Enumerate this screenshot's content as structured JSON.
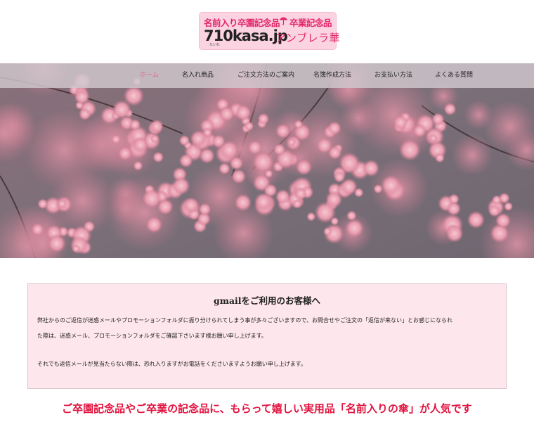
{
  "logo": {
    "line1_a": "名前入り卒園記念品",
    "line1_b": "卒業記念品",
    "domain": "710kasa.jp",
    "ruby": "ないれ",
    "brand": "アンブレラ華",
    "accent": "#e2266a",
    "background": "#fbd3e1",
    "icon": "umbrella-icon"
  },
  "nav": {
    "items": [
      {
        "label": "ホーム",
        "active": true
      },
      {
        "label": "名入れ商品",
        "active": false
      },
      {
        "label": "ご注文方法のご案内",
        "active": false
      },
      {
        "label": "名簿作成方法",
        "active": false
      },
      {
        "label": "お支払い方法",
        "active": false
      },
      {
        "label": "よくある質問",
        "active": false
      }
    ],
    "active_color": "#e45f8f"
  },
  "notice": {
    "title": "gmailをご利用のお客様へ",
    "paragraph1_line1": "弊社からのご返信が迷惑メールやプロモーションフォルダに振り分けられてしまう事が多々ございますので、お問合せやご注文の「返信が来ない」とお感じになられ",
    "paragraph1_line2": "た際は、迷惑メール、プロモーションフォルダをご確認下さいます様お願い申し上げます。",
    "paragraph2": "それでも返信メールが見当たらない際は、恐れ入りますがお電話をくださいますようお願い申し上げます。",
    "background": "#fde6ec"
  },
  "tagline": {
    "text": "ご卒園記念品やご卒業の記念品に、もらって嬉しい実用品「名前入りの傘」が人気です",
    "color": "#e2133f"
  }
}
